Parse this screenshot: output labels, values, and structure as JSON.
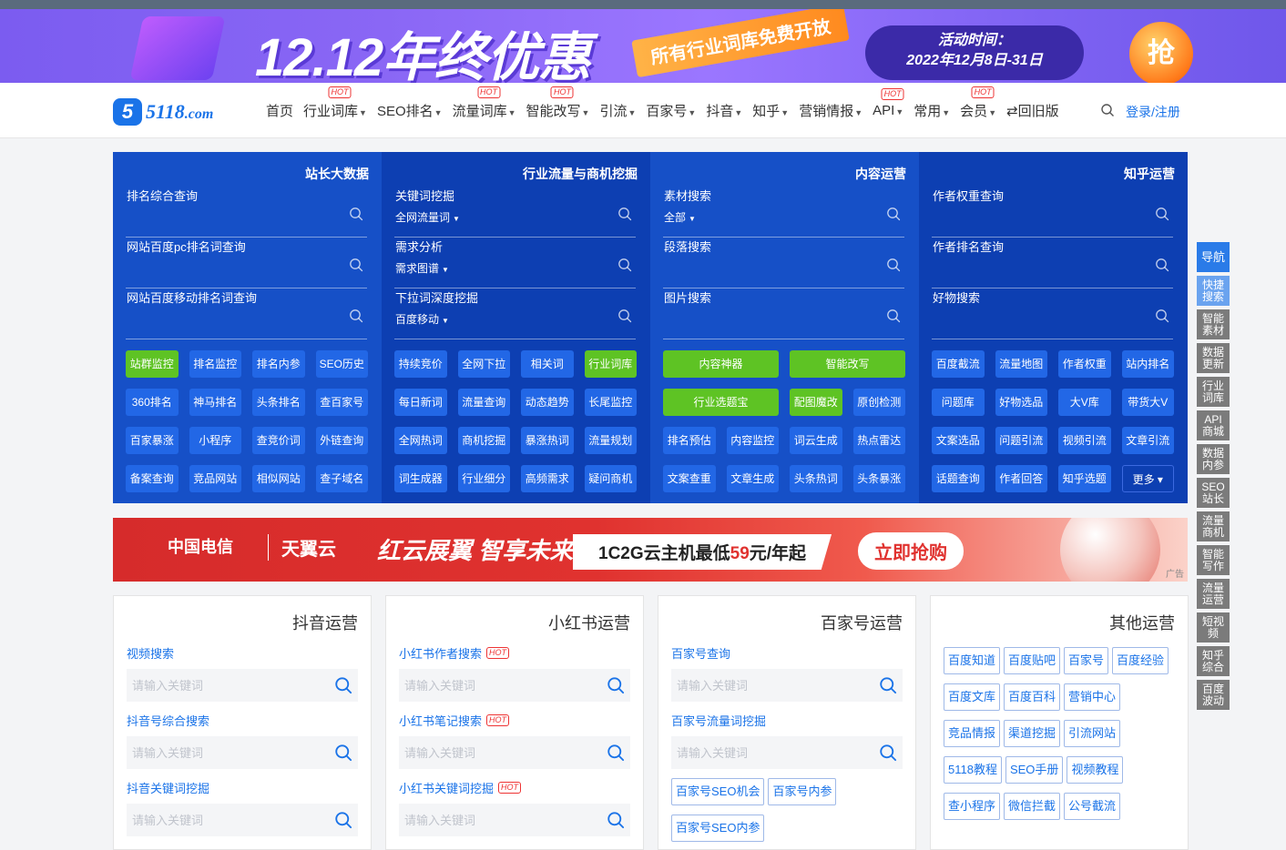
{
  "banner": {
    "headline": "12.12年终优惠",
    "slant": "所有行业词库免费开放",
    "period_label": "活动时间：",
    "period_dates": "2022年12月8日-31日",
    "grab": "抢"
  },
  "logo": {
    "mark": "5",
    "text": "5118",
    "suffix": ".com"
  },
  "menu": [
    {
      "label": "首页",
      "caret": false,
      "hot": false
    },
    {
      "label": "行业词库",
      "caret": true,
      "hot": true
    },
    {
      "label": "SEO排名",
      "caret": true,
      "hot": false
    },
    {
      "label": "流量词库",
      "caret": true,
      "hot": true
    },
    {
      "label": "智能改写",
      "caret": true,
      "hot": true
    },
    {
      "label": "引流",
      "caret": true,
      "hot": false
    },
    {
      "label": "百家号",
      "caret": true,
      "hot": false
    },
    {
      "label": "抖音",
      "caret": true,
      "hot": false
    },
    {
      "label": "知乎",
      "caret": true,
      "hot": false
    },
    {
      "label": "营销情报",
      "caret": true,
      "hot": false
    },
    {
      "label": "API",
      "caret": true,
      "hot": true
    },
    {
      "label": "常用",
      "caret": true,
      "hot": false
    },
    {
      "label": "会员",
      "caret": true,
      "hot": true
    },
    {
      "label": "⇄回旧版",
      "caret": false,
      "hot": false
    }
  ],
  "hot_label": "HOT",
  "login": "登录/注册",
  "panel": [
    {
      "head": "站长大数据",
      "fields": [
        {
          "label": "排名综合查询",
          "sub": ""
        },
        {
          "label": "网站百度pc排名词查询",
          "sub": ""
        },
        {
          "label": "网站百度移动排名词查询",
          "sub": ""
        }
      ],
      "buttons": [
        {
          "t": "站群监控",
          "g": true
        },
        {
          "t": "排名监控"
        },
        {
          "t": "排名内参"
        },
        {
          "t": "SEO历史"
        },
        {
          "t": "360排名"
        },
        {
          "t": "神马排名"
        },
        {
          "t": "头条排名"
        },
        {
          "t": "查百家号"
        },
        {
          "t": "百家暴涨"
        },
        {
          "t": "小程序"
        },
        {
          "t": "查竞价词"
        },
        {
          "t": "外链查询"
        },
        {
          "t": "备案查询"
        },
        {
          "t": "竞品网站"
        },
        {
          "t": "相似网站"
        },
        {
          "t": "查子域名"
        }
      ]
    },
    {
      "head": "行业流量与商机挖掘",
      "fields": [
        {
          "label": "关键词挖掘",
          "sub": "全网流量词"
        },
        {
          "label": "需求分析",
          "sub": "需求图谱"
        },
        {
          "label": "下拉词深度挖掘",
          "sub": "百度移动"
        }
      ],
      "buttons": [
        {
          "t": "持续竞价"
        },
        {
          "t": "全网下拉"
        },
        {
          "t": "相关词"
        },
        {
          "t": "行业词库",
          "g": true
        },
        {
          "t": "每日新词"
        },
        {
          "t": "流量查询"
        },
        {
          "t": "动态趋势"
        },
        {
          "t": "长尾监控"
        },
        {
          "t": "全网热词"
        },
        {
          "t": "商机挖掘"
        },
        {
          "t": "暴涨热词"
        },
        {
          "t": "流量规划"
        },
        {
          "t": "词生成器"
        },
        {
          "t": "行业细分"
        },
        {
          "t": "高频需求"
        },
        {
          "t": "疑问商机"
        }
      ]
    },
    {
      "head": "内容运营",
      "fields": [
        {
          "label": "素材搜索",
          "sub": "全部"
        },
        {
          "label": "段落搜索",
          "sub": ""
        },
        {
          "label": "图片搜索",
          "sub": ""
        }
      ],
      "buttons": [
        {
          "t": "内容神器",
          "g": true,
          "w": 2
        },
        {
          "t": "智能改写",
          "g": true,
          "w": 2
        },
        {
          "t": "行业选题宝",
          "g": true,
          "w": 2
        },
        {
          "t": "配图魔改",
          "g": true
        },
        {
          "t": "原创检测"
        },
        {
          "t": "排名预估"
        },
        {
          "t": "内容监控"
        },
        {
          "t": "词云生成"
        },
        {
          "t": "热点雷达"
        },
        {
          "t": "文案查重"
        },
        {
          "t": "文章生成"
        },
        {
          "t": "头条热词"
        },
        {
          "t": "头条暴涨"
        }
      ]
    },
    {
      "head": "知乎运营",
      "fields": [
        {
          "label": "作者权重查询",
          "sub": ""
        },
        {
          "label": "作者排名查询",
          "sub": ""
        },
        {
          "label": "好物搜索",
          "sub": ""
        }
      ],
      "buttons": [
        {
          "t": "百度截流"
        },
        {
          "t": "流量地图"
        },
        {
          "t": "作者权重"
        },
        {
          "t": "站内排名"
        },
        {
          "t": "问题库"
        },
        {
          "t": "好物选品"
        },
        {
          "t": "大V库"
        },
        {
          "t": "带货大V"
        },
        {
          "t": "文案选品"
        },
        {
          "t": "问题引流"
        },
        {
          "t": "视频引流"
        },
        {
          "t": "文章引流"
        },
        {
          "t": "话题查询"
        },
        {
          "t": "作者回答"
        },
        {
          "t": "知乎选题"
        },
        {
          "t": "更多 ▾",
          "more": true
        }
      ]
    }
  ],
  "ad": {
    "brand1": "中国电信",
    "brand2": "天翼云",
    "slogan": "红云展翼 智享未来",
    "offer_pre": "1C2G云主机最低",
    "offer_price": "59",
    "offer_post": "元/年起",
    "button": "立即抢购",
    "tag": "广告"
  },
  "placeholder": "请输入关键词",
  "cards": [
    {
      "title": "抖音运营",
      "queries": [
        {
          "label": "视频搜索",
          "hot": false
        },
        {
          "label": "抖音号综合搜索",
          "hot": false
        },
        {
          "label": "抖音关键词挖掘",
          "hot": false
        }
      ]
    },
    {
      "title": "小红书运营",
      "queries": [
        {
          "label": "小红书作者搜索",
          "hot": true
        },
        {
          "label": "小红书笔记搜索",
          "hot": true
        },
        {
          "label": "小红书关键词挖掘",
          "hot": true
        }
      ]
    },
    {
      "title": "百家号运营",
      "queries": [
        {
          "label": "百家号查询",
          "hot": false
        },
        {
          "label": "百家号流量词挖掘",
          "hot": false
        }
      ],
      "tags": [
        "百家号SEO机会",
        "百家号内参",
        "百家号SEO内参"
      ]
    },
    {
      "title": "其他运营",
      "tags": [
        "百度知道",
        "百度贴吧",
        "百家号",
        "百度经验",
        "百度文库",
        "百度百科",
        "营销中心",
        "竞品情报",
        "渠道挖掘",
        "引流网站",
        "5118教程",
        "SEO手册",
        "视频教程",
        "查小程序",
        "微信拦截",
        "公号截流"
      ]
    }
  ],
  "sidebar": [
    "导航",
    "快捷搜索",
    "智能素材",
    "数据更新",
    "行业词库",
    "API商城",
    "数据内参",
    "SEO站长",
    "流量商机",
    "智能写作",
    "流量运营",
    "短视频",
    "知乎综合",
    "百度波动"
  ],
  "colors": {
    "brand": "#1a73e8",
    "panel_dark": "#0d3fb2",
    "panel_light": "#1650c7",
    "green": "#5ec324",
    "hot": "#e33"
  }
}
